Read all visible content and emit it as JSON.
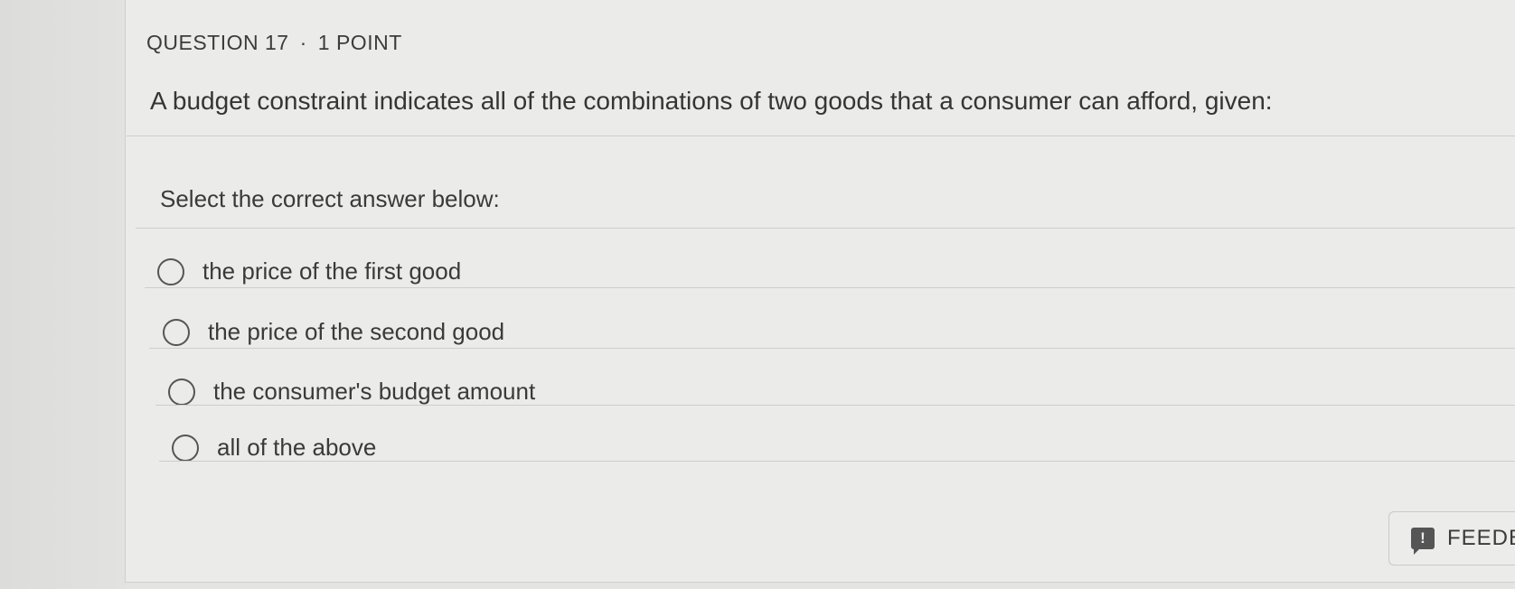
{
  "question": {
    "number_label": "QUESTION 17",
    "separator": "·",
    "points_label": "1 POINT",
    "text": "A budget constraint indicates all of the combinations of two goods that a consumer can afford, given:"
  },
  "prompt": "Select the correct answer below:",
  "options": [
    {
      "label": "the price of the first good",
      "selected": false
    },
    {
      "label": "the price of the second good",
      "selected": false
    },
    {
      "label": "the consumer's budget amount",
      "selected": false
    },
    {
      "label": "all of the above",
      "selected": false
    }
  ],
  "feedback_button": {
    "icon": "feedback-icon",
    "icon_glyph": "!",
    "label": "FEEDB"
  }
}
